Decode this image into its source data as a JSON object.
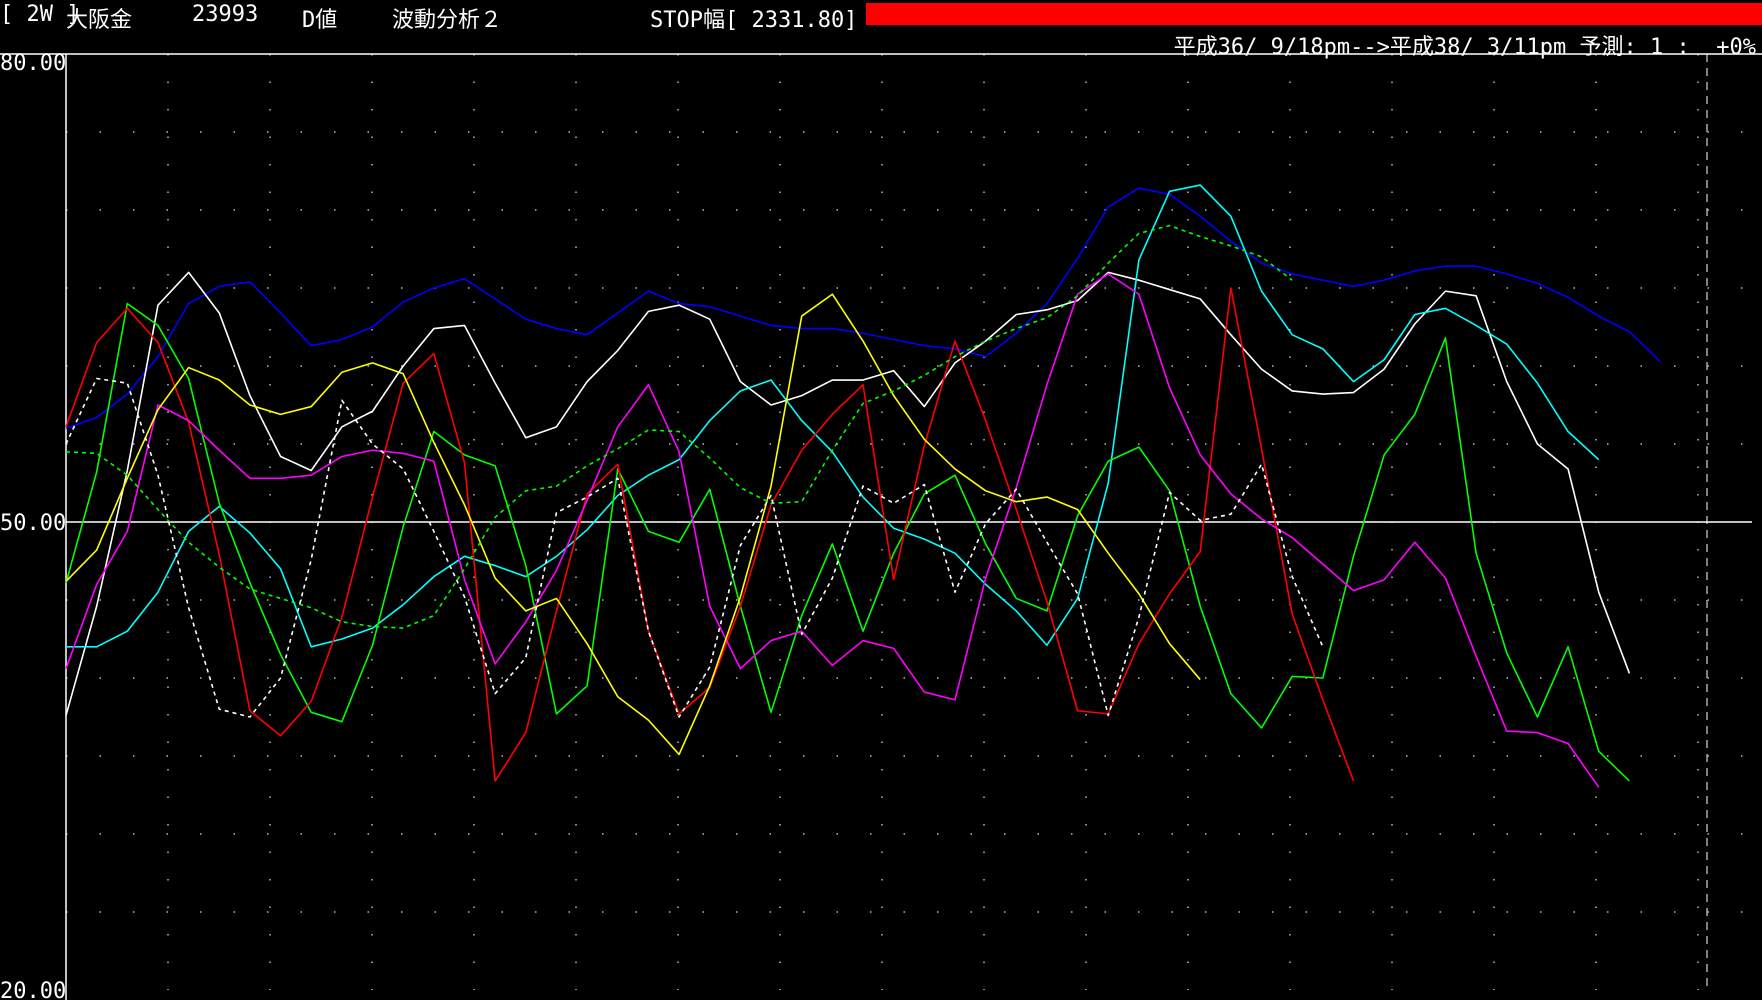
{
  "header": {
    "period": "[ 2W ]",
    "market": "大阪金",
    "code": "23993",
    "value_type": "D値",
    "analysis": "波動分析２",
    "stop_width": "STOP幅[ 2331.80]",
    "range": "平成36/ 9/18pm-->平成38/ 3/11pm 予測: 1 :  +0%"
  },
  "colors": {
    "background": "#000000",
    "stop_bar": "#ff0000",
    "blue": "#0000ff",
    "white": "#ffffff",
    "cyan": "#00ffff",
    "green": "#00ff00",
    "red": "#ff0000",
    "magenta": "#ff00ff",
    "yellow": "#ffff00"
  },
  "chart_data": {
    "type": "line",
    "ylim": [
      20,
      80
    ],
    "ytick_labels": [
      "80.00",
      "50.00",
      "20.00"
    ],
    "midline": 50,
    "grid": "dotted",
    "x": [
      0,
      1,
      2,
      3,
      4,
      5,
      6,
      7,
      8,
      9,
      10,
      11,
      12,
      13,
      14,
      15,
      16,
      17,
      18,
      19,
      20,
      21,
      22,
      23,
      24,
      25,
      26,
      27,
      28,
      29,
      30,
      31,
      32,
      33,
      34,
      35,
      36,
      37,
      38,
      39,
      40,
      41,
      42,
      43,
      44,
      45,
      46,
      47,
      48,
      49,
      50,
      51,
      52,
      53,
      54,
      55
    ],
    "series": [
      {
        "color": "#0000ff",
        "style": "solid",
        "values": [
          56.0,
          56.7,
          58.2,
          60.6,
          64.0,
          65.1,
          65.4,
          63.4,
          61.3,
          61.7,
          62.5,
          64.1,
          65.0,
          65.6,
          64.3,
          63.0,
          62.4,
          62.0,
          63.4,
          64.8,
          64.0,
          63.8,
          63.2,
          62.6,
          62.4,
          62.4,
          62.1,
          61.7,
          61.3,
          61.1,
          60.6,
          62.1,
          64.0,
          66.9,
          70.2,
          71.4,
          71.0,
          69.6,
          68.0,
          66.6,
          65.9,
          65.5,
          65.1,
          65.5,
          66.1,
          66.4,
          66.4,
          65.9,
          65.3,
          64.4,
          63.2,
          62.2,
          60.3
        ]
      },
      {
        "color": "#ffffff",
        "style": "solid",
        "values": [
          37.6,
          44.6,
          53.3,
          63.9,
          66.0,
          63.4,
          58.1,
          54.2,
          53.3,
          56.1,
          57.1,
          60.0,
          62.4,
          62.6,
          58.9,
          55.4,
          56.1,
          59.0,
          61.0,
          63.5,
          63.9,
          63.0,
          59.0,
          57.5,
          58.1,
          59.1,
          59.1,
          59.7,
          57.4,
          60.2,
          61.6,
          63.3,
          63.6,
          64.2,
          66.0,
          65.5,
          64.9,
          64.3,
          62.0,
          59.8,
          58.4,
          58.2,
          58.3,
          59.8,
          62.7,
          64.8,
          64.5,
          59.0,
          55.0,
          53.4,
          45.5,
          40.3
        ]
      },
      {
        "color": "#00ffff",
        "style": "solid",
        "values": [
          42.0,
          42.0,
          43.0,
          45.5,
          49.4,
          51.0,
          49.3,
          47.0,
          42.0,
          42.5,
          43.2,
          44.7,
          46.5,
          47.8,
          47.2,
          46.5,
          47.8,
          49.5,
          51.7,
          53.0,
          54.0,
          56.5,
          58.4,
          59.1,
          56.5,
          54.5,
          51.6,
          49.6,
          48.9,
          48.0,
          46.0,
          44.3,
          42.1,
          45.1,
          52.5,
          66.8,
          71.2,
          71.6,
          69.6,
          64.8,
          62.0,
          61.1,
          59.0,
          60.4,
          63.3,
          63.7,
          62.6,
          61.4,
          58.9,
          55.8,
          54.0
        ]
      },
      {
        "color": "#00ff00",
        "style": "solid",
        "values": [
          46.1,
          53.2,
          64.0,
          62.6,
          59.2,
          51.2,
          46.1,
          41.5,
          37.8,
          37.2,
          42.1,
          49.7,
          55.8,
          54.3,
          53.6,
          47.2,
          37.7,
          39.5,
          53.4,
          49.4,
          48.7,
          52.1,
          44.6,
          37.8,
          44.0,
          48.6,
          43.0,
          48.0,
          51.8,
          53.0,
          48.6,
          45.1,
          44.3,
          50.4,
          53.9,
          54.8,
          52.0,
          44.6,
          39.0,
          36.8,
          40.1,
          40.0,
          47.8,
          54.3,
          56.9,
          61.8,
          48.0,
          41.6,
          37.5,
          42.0,
          35.3,
          33.4
        ]
      },
      {
        "color": "#ff0000",
        "style": "solid",
        "values": [
          56.1,
          61.5,
          63.7,
          61.5,
          56.4,
          47.9,
          37.9,
          36.3,
          38.5,
          43.9,
          51.6,
          58.9,
          60.8,
          53.8,
          33.4,
          36.5,
          44.3,
          51.8,
          53.7,
          43.0,
          37.7,
          39.4,
          44.6,
          51.1,
          54.6,
          56.9,
          58.8,
          46.3,
          54.9,
          61.6,
          56.5,
          50.8,
          44.9,
          37.9,
          37.7,
          42.2,
          45.4,
          48.1,
          65.0,
          54.7,
          44.1,
          38.6,
          33.4
        ]
      },
      {
        "color": "#ff00ff",
        "style": "solid",
        "values": [
          40.6,
          46.0,
          49.4,
          57.5,
          56.5,
          54.6,
          52.8,
          52.8,
          53.0,
          54.2,
          54.6,
          54.4,
          53.9,
          46.3,
          40.9,
          43.6,
          46.9,
          51.4,
          56.1,
          58.8,
          54.5,
          44.6,
          40.6,
          42.4,
          43.0,
          40.8,
          42.4,
          41.9,
          39.1,
          38.6,
          46.4,
          52.2,
          58.8,
          64.6,
          65.9,
          64.6,
          58.6,
          54.3,
          51.8,
          50.2,
          49.0,
          47.3,
          45.6,
          46.3,
          48.7,
          46.4,
          41.4,
          36.6,
          36.5,
          35.8,
          33.0
        ]
      },
      {
        "color": "#ffff00",
        "style": "solid",
        "values": [
          46.2,
          48.2,
          52.8,
          57.2,
          59.9,
          59.1,
          57.5,
          56.9,
          57.4,
          59.6,
          60.2,
          59.5,
          55.1,
          51.1,
          46.4,
          44.3,
          45.1,
          42.2,
          38.8,
          37.3,
          35.1,
          39.5,
          45.2,
          52.3,
          63.2,
          64.6,
          61.6,
          58.1,
          55.3,
          53.4,
          52.0,
          51.3,
          51.6,
          50.8,
          48.0,
          45.4,
          42.2,
          39.9
        ]
      },
      {
        "color": "#00ff00",
        "style": "dashed",
        "values": [
          54.5,
          54.4,
          53.0,
          50.8,
          48.7,
          47.1,
          45.7,
          45.1,
          44.5,
          43.6,
          43.3,
          43.2,
          44.0,
          47.0,
          50.3,
          52.0,
          52.3,
          53.6,
          54.7,
          55.9,
          55.8,
          54.1,
          52.2,
          51.2,
          51.3,
          54.6,
          57.6,
          58.4,
          59.4,
          60.6,
          61.6,
          62.4,
          63.1,
          64.5,
          66.6,
          68.5,
          69.0,
          68.3,
          67.7,
          67.0,
          65.5
        ]
      },
      {
        "color": "#ffffff",
        "style": "dashed",
        "values": [
          55.0,
          59.2,
          58.9,
          53.0,
          44.5,
          38.0,
          37.5,
          40.0,
          47.6,
          57.8,
          55.0,
          53.4,
          49.4,
          45.2,
          39.0,
          41.3,
          50.6,
          51.6,
          52.8,
          43.0,
          37.5,
          40.7,
          48.5,
          51.7,
          42.8,
          46.4,
          52.3,
          51.2,
          52.4,
          45.5,
          49.9,
          52.1,
          48.7,
          45.4,
          37.6,
          43.9,
          51.9,
          50.1,
          50.5,
          53.7,
          46.5,
          42.0
        ]
      }
    ]
  }
}
